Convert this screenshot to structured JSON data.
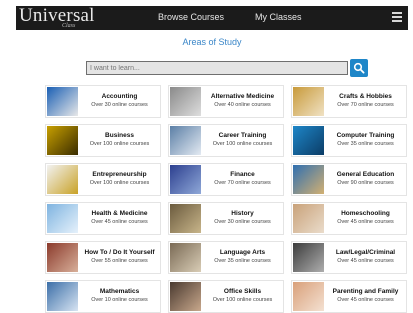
{
  "header": {
    "logo_text": "Universal",
    "logo_sub": "Class",
    "nav": [
      "Browse Courses",
      "My Classes"
    ],
    "menu_icon": "hamburger-menu-icon"
  },
  "page": {
    "title": "Areas of Study"
  },
  "search": {
    "placeholder": "I want to learn...",
    "value": "",
    "button_icon": "search-icon"
  },
  "colors": {
    "accent": "#1e86c8",
    "topbar": "#1b1b1b"
  },
  "categories": [
    {
      "title": "Accounting",
      "count": "Over 30 online courses",
      "thumb": "accounting-thumb-icon"
    },
    {
      "title": "Alternative Medicine",
      "count": "Over 40 online courses",
      "thumb": "alternative-medicine-thumb-icon"
    },
    {
      "title": "Crafts & Hobbies",
      "count": "Over 70 online courses",
      "thumb": "crafts-hobbies-thumb-icon"
    },
    {
      "title": "Business",
      "count": "Over 100 online courses",
      "thumb": "business-thumb-icon"
    },
    {
      "title": "Career Training",
      "count": "Over 100 online courses",
      "thumb": "career-training-thumb-icon"
    },
    {
      "title": "Computer Training",
      "count": "Over 35 online courses",
      "thumb": "computer-training-thumb-icon"
    },
    {
      "title": "Entrepreneurship",
      "count": "Over 100 online courses",
      "thumb": "entrepreneurship-thumb-icon"
    },
    {
      "title": "Finance",
      "count": "Over 70 online courses",
      "thumb": "finance-thumb-icon"
    },
    {
      "title": "General Education",
      "count": "Over 90 online courses",
      "thumb": "general-education-thumb-icon"
    },
    {
      "title": "Health & Medicine",
      "count": "Over 45 online courses",
      "thumb": "health-medicine-thumb-icon"
    },
    {
      "title": "History",
      "count": "Over 30 online courses",
      "thumb": "history-thumb-icon"
    },
    {
      "title": "Homeschooling",
      "count": "Over 45 online courses",
      "thumb": "homeschooling-thumb-icon"
    },
    {
      "title": "How To / Do It Yourself",
      "count": "Over 55 online courses",
      "thumb": "how-to-diy-thumb-icon"
    },
    {
      "title": "Language Arts",
      "count": "Over 35 online courses",
      "thumb": "language-arts-thumb-icon"
    },
    {
      "title": "Law/Legal/Criminal",
      "count": "Over 45 online courses",
      "thumb": "law-legal-thumb-icon"
    },
    {
      "title": "Mathematics",
      "count": "Over 10 online courses",
      "thumb": "mathematics-thumb-icon"
    },
    {
      "title": "Office Skills",
      "count": "Over 100 online courses",
      "thumb": "office-skills-thumb-icon"
    },
    {
      "title": "Parenting and Family",
      "count": "Over 45 online courses",
      "thumb": "parenting-family-thumb-icon"
    }
  ]
}
